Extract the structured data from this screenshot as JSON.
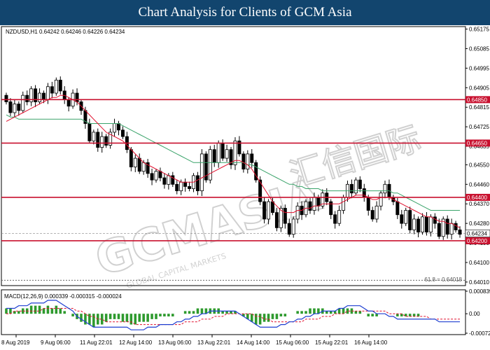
{
  "banner": {
    "title": "Chart Analysis for Clients of GCM Asia"
  },
  "watermark": {
    "brand": "GCMASIA",
    "chinese": "汇信国际",
    "tagline": "GLOBAL CAPITAL MARKETS"
  },
  "chart_data": {
    "type": "candlestick",
    "symbol_header": "NZDUSD,H1  0.64242 0.64246 0.64226 0.64234",
    "y_ticks": [
      "0.65175",
      "0.65085",
      "0.64995",
      "0.64905",
      "0.64815",
      "0.64725",
      "0.64635",
      "0.64550",
      "0.64460",
      "0.64370",
      "0.64280",
      "0.64190",
      "0.64100",
      "0.64010"
    ],
    "ylim": [
      0.64,
      0.6518
    ],
    "levels": [
      {
        "label": "0.64850",
        "value": 0.6485
      },
      {
        "label": "0.64650",
        "value": 0.6465
      },
      {
        "label": "0.64400",
        "value": 0.644
      },
      {
        "label": "0.64200",
        "value": 0.642
      }
    ],
    "current_price": {
      "label": "0.64234",
      "value": 0.64234
    },
    "fib_label": "61.8 = 0.64018",
    "fib_value": 0.64018,
    "x_ticks": [
      "8 Aug 2019",
      "9 Aug 06:00",
      "11 Aug 22:01",
      "12 Aug 14:00",
      "13 Aug 06:00",
      "13 Aug 22:01",
      "14 Aug 14:00",
      "15 Aug 06:00",
      "15 Aug 22:01",
      "16 Aug 14:00"
    ],
    "closes": [
      0.6484,
      0.6479,
      0.6483,
      0.648,
      0.6487,
      0.6484,
      0.649,
      0.6484,
      0.6488,
      0.6485,
      0.6491,
      0.6488,
      0.6494,
      0.6489,
      0.6485,
      0.6482,
      0.6488,
      0.6484,
      0.648,
      0.6474,
      0.6466,
      0.647,
      0.6463,
      0.6468,
      0.6464,
      0.647,
      0.6474,
      0.6471,
      0.6468,
      0.6462,
      0.6454,
      0.6458,
      0.6452,
      0.6456,
      0.6451,
      0.6448,
      0.6452,
      0.6449,
      0.6446,
      0.645,
      0.6446,
      0.6443,
      0.6447,
      0.6445,
      0.6444,
      0.645,
      0.6443,
      0.646,
      0.6448,
      0.6462,
      0.6456,
      0.6465,
      0.6458,
      0.6462,
      0.6455,
      0.6466,
      0.646,
      0.6453,
      0.646,
      0.6456,
      0.6448,
      0.6438,
      0.643,
      0.6438,
      0.6433,
      0.6426,
      0.6435,
      0.6428,
      0.6423,
      0.643,
      0.6436,
      0.6432,
      0.6438,
      0.6434,
      0.644,
      0.6436,
      0.6442,
      0.6438,
      0.6432,
      0.6428,
      0.6434,
      0.644,
      0.6446,
      0.6442,
      0.6448,
      0.6444,
      0.644,
      0.6434,
      0.643,
      0.6436,
      0.6442,
      0.6446,
      0.644,
      0.6438,
      0.6432,
      0.6428,
      0.6434,
      0.6425,
      0.643,
      0.6424,
      0.6431,
      0.6424,
      0.6431,
      0.6428,
      0.6422,
      0.643,
      0.6423,
      0.6428,
      0.6425,
      0.6423
    ],
    "ema_fast": [
      0.6475,
      0.6476,
      0.6477,
      0.6478,
      0.6479,
      0.648,
      0.6481,
      0.6482,
      0.6483,
      0.6484,
      0.6485,
      0.6486,
      0.6486,
      0.6487,
      0.6487,
      0.6486,
      0.6485,
      0.6484,
      0.6482,
      0.648,
      0.6478,
      0.6476,
      0.6474,
      0.6472,
      0.647,
      0.6469,
      0.6468,
      0.6467,
      0.6466,
      0.6464,
      0.6462,
      0.646,
      0.6458,
      0.6456,
      0.6455,
      0.6454,
      0.6453,
      0.6452,
      0.6451,
      0.645,
      0.6449,
      0.6448,
      0.6447,
      0.6447,
      0.6447,
      0.6447,
      0.6448,
      0.6449,
      0.645,
      0.6451,
      0.6452,
      0.6453,
      0.6454,
      0.6455,
      0.6456,
      0.6457,
      0.6457,
      0.6456,
      0.6455,
      0.6453,
      0.645,
      0.6447,
      0.6444,
      0.6441,
      0.6438,
      0.6436,
      0.6434,
      0.6433,
      0.6433,
      0.6433,
      0.6434,
      0.6434,
      0.6435,
      0.6435,
      0.6436,
      0.6436,
      0.6437,
      0.6437,
      0.6437,
      0.6437,
      0.6437,
      0.6438,
      0.6439,
      0.644,
      0.6441,
      0.6441,
      0.6441,
      0.644,
      0.6439,
      0.6439,
      0.644,
      0.644,
      0.644,
      0.6439,
      0.6438,
      0.6437,
      0.6436,
      0.6435,
      0.6434,
      0.6433,
      0.6432,
      0.6431,
      0.6431,
      0.643,
      0.6429,
      0.6429,
      0.6428,
      0.6428,
      0.6427,
      0.6426
    ],
    "ema_slow": [
      0.6478,
      0.6477,
      0.6477,
      0.6476,
      0.6476,
      0.6476,
      0.6476,
      0.6476,
      0.6476,
      0.6476,
      0.6476,
      0.6476,
      0.6476,
      0.6476,
      0.6476,
      0.6476,
      0.6476,
      0.6476,
      0.6476,
      0.6475,
      0.6474,
      0.6474,
      0.6474,
      0.6474,
      0.6474,
      0.6474,
      0.6474,
      0.6474,
      0.6473,
      0.6472,
      0.6471,
      0.647,
      0.6469,
      0.6468,
      0.6467,
      0.6466,
      0.6465,
      0.6464,
      0.6463,
      0.6462,
      0.6461,
      0.646,
      0.6459,
      0.6458,
      0.6457,
      0.6456,
      0.6456,
      0.6456,
      0.6456,
      0.6456,
      0.6456,
      0.6456,
      0.6456,
      0.6456,
      0.6456,
      0.6456,
      0.6456,
      0.6456,
      0.6455,
      0.6455,
      0.6454,
      0.6453,
      0.6452,
      0.6451,
      0.645,
      0.6449,
      0.6448,
      0.6447,
      0.6446,
      0.6446,
      0.6445,
      0.6445,
      0.6444,
      0.6444,
      0.6444,
      0.6444,
      0.6443,
      0.6443,
      0.6443,
      0.6443,
      0.6443,
      0.6443,
      0.6443,
      0.6443,
      0.6443,
      0.6443,
      0.6443,
      0.6443,
      0.6443,
      0.6443,
      0.6443,
      0.6443,
      0.6443,
      0.6442,
      0.6442,
      0.6441,
      0.644,
      0.6439,
      0.6438,
      0.6437,
      0.6436,
      0.6435,
      0.6434,
      0.6434,
      0.6434,
      0.6434,
      0.6434,
      0.6434,
      0.6434,
      0.6434
    ],
    "macd": {
      "label": "MACD(12,26,9) 0.000339 -0.000315 -0.000024",
      "y_ticks": [
        "0.000839",
        "0.00",
        "-0.000724"
      ],
      "ylim": [
        -0.000724,
        0.000839
      ],
      "hist": [
        0.0002,
        0.0002,
        0.0001,
        0.0001,
        0.0002,
        0.0002,
        0.0003,
        0.0003,
        0.0003,
        0.0002,
        0.0003,
        0.0002,
        0.0003,
        0.0002,
        0.0001,
        0.0,
        -0.0001,
        -0.0002,
        -0.0003,
        -0.0004,
        -0.0004,
        -0.0005,
        -0.0004,
        -0.0004,
        -0.0003,
        -0.0002,
        -0.0002,
        -0.0002,
        -0.0003,
        -0.0003,
        -0.0004,
        -0.0004,
        -0.0003,
        -0.0003,
        -0.0003,
        -0.0002,
        -0.0002,
        -0.0001,
        -0.0001,
        -0.0001,
        -0.0001,
        0.0,
        0.0,
        0.0001,
        0.0001,
        0.0001,
        0.0002,
        0.0002,
        0.0002,
        0.0002,
        0.0002,
        0.0002,
        0.0001,
        0.0001,
        0.0001,
        0.0001,
        0.0,
        -0.0001,
        -0.0002,
        -0.0003,
        -0.0004,
        -0.0004,
        -0.0003,
        -0.0003,
        -0.0002,
        -0.0002,
        -0.0001,
        -0.0001,
        0.0,
        0.0,
        0.0001,
        0.0001,
        0.0001,
        0.0002,
        0.0002,
        0.0002,
        0.0002,
        0.0001,
        0.0001,
        0.0001,
        0.0002,
        0.0002,
        0.0002,
        0.0002,
        0.0001,
        0.0001,
        0.0,
        -0.0001,
        -0.0001,
        -0.0001,
        0.0,
        0.0,
        0.0,
        0.0,
        -0.0001,
        -0.0001,
        -0.0001,
        -0.0001,
        -0.0001,
        -0.0001,
        0.0,
        0.0,
        0.0,
        0.0,
        0.0,
        0.0,
        0.0,
        0.0,
        0.0,
        0.0
      ],
      "macd_line": [
        0.0002,
        0.0002,
        0.0002,
        0.0003,
        0.0003,
        0.0003,
        0.0004,
        0.0004,
        0.0004,
        0.0004,
        0.0005,
        0.0005,
        0.0005,
        0.0004,
        0.0003,
        0.0002,
        0.0001,
        -0.0001,
        -0.0002,
        -0.0003,
        -0.0004,
        -0.0005,
        -0.0005,
        -0.0005,
        -0.0005,
        -0.0005,
        -0.0005,
        -0.0005,
        -0.0005,
        -0.0005,
        -0.0006,
        -0.0006,
        -0.0006,
        -0.0006,
        -0.0005,
        -0.0005,
        -0.0005,
        -0.0004,
        -0.0004,
        -0.0004,
        -0.0004,
        -0.0003,
        -0.0003,
        -0.0002,
        -0.0002,
        -0.0001,
        -0.0001,
        0.0,
        0.0,
        0.0001,
        0.0001,
        0.0001,
        0.0001,
        0.0001,
        0.0001,
        0.0001,
        0.0,
        -0.0001,
        -0.0002,
        -0.0003,
        -0.0004,
        -0.0005,
        -0.0005,
        -0.0005,
        -0.0005,
        -0.0005,
        -0.0004,
        -0.0004,
        -0.0003,
        -0.0003,
        -0.0002,
        -0.0002,
        -0.0001,
        -0.0001,
        0.0,
        0.0,
        0.0001,
        0.0001,
        0.0001,
        0.0001,
        0.0002,
        0.0002,
        0.0003,
        0.0003,
        0.0003,
        0.0003,
        0.0002,
        0.0001,
        0.0001,
        0.0,
        0.0,
        0.0,
        -0.0001,
        -0.0001,
        -0.0002,
        -0.0002,
        -0.0002,
        -0.0002,
        -0.0002,
        -0.0002,
        -0.0002,
        -0.0002,
        -0.0002,
        -0.0002,
        -0.0003,
        -0.0003,
        -0.0003,
        -0.0003,
        -0.0003,
        -0.0003
      ],
      "signal_line": [
        0.0,
        0.0,
        0.0001,
        0.0001,
        0.0001,
        0.0001,
        0.0001,
        0.0001,
        0.0001,
        0.0002,
        0.0002,
        0.0002,
        0.0002,
        0.0002,
        0.0002,
        0.0002,
        0.0002,
        0.0001,
        0.0001,
        0.0,
        -0.0001,
        -0.0001,
        -0.0002,
        -0.0002,
        -0.0003,
        -0.0003,
        -0.0003,
        -0.0003,
        -0.0003,
        -0.0003,
        -0.0003,
        -0.0004,
        -0.0004,
        -0.0004,
        -0.0004,
        -0.0004,
        -0.0004,
        -0.0004,
        -0.0004,
        -0.0004,
        -0.0004,
        -0.0004,
        -0.0004,
        -0.0003,
        -0.0003,
        -0.0003,
        -0.0003,
        -0.0002,
        -0.0002,
        -0.0002,
        -0.0001,
        -0.0001,
        -0.0001,
        0.0,
        0.0,
        0.0,
        0.0,
        0.0,
        0.0,
        0.0,
        -0.0001,
        -0.0001,
        -0.0002,
        -0.0002,
        -0.0003,
        -0.0003,
        -0.0003,
        -0.0003,
        -0.0003,
        -0.0003,
        -0.0003,
        -0.0003,
        -0.0002,
        -0.0002,
        -0.0002,
        -0.0002,
        -0.0001,
        -0.0001,
        -0.0001,
        0.0,
        0.0,
        0.0,
        0.0001,
        0.0001,
        0.0001,
        0.0001,
        0.0001,
        0.0001,
        0.0001,
        0.0001,
        0.0001,
        0.0001,
        0.0,
        0.0,
        0.0,
        0.0,
        -0.0001,
        -0.0001,
        -0.0001,
        -0.0001,
        -0.0001,
        -0.0001,
        -0.0002,
        -0.0002,
        -0.0002,
        -0.0002,
        -0.0002,
        -0.0002,
        -0.0002,
        -0.0002
      ]
    }
  },
  "colors": {
    "banner_bg": "#12456e",
    "level_line": "#c8102e",
    "label_bg": "#c8102e",
    "ema_fast": "#e0102e",
    "ema_slow": "#3aa36a",
    "macd_line": "#1f3fd1",
    "signal_line": "#e0102e",
    "hist": "#2e9a2e",
    "candle": "#000000"
  }
}
